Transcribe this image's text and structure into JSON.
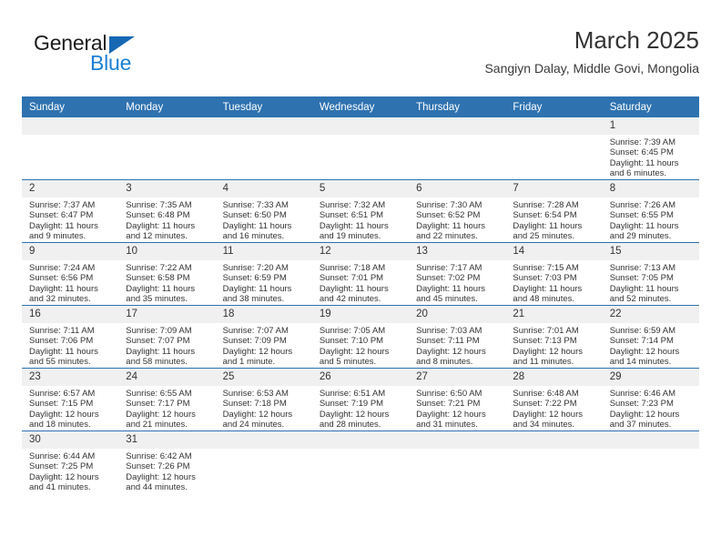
{
  "logo": {
    "word_one": "General",
    "word_two": "Blue",
    "triangle_icon": "blue-triangle-icon",
    "accent_color": "#1668b3",
    "blue_text_color": "#1b7fd4"
  },
  "header": {
    "title": "March 2025",
    "subtitle": "Sangiyn Dalay, Middle Govi, Mongolia"
  },
  "theme": {
    "header_blue": "#2e72b0",
    "daynum_gray": "#f0f0f0",
    "text": "#333333"
  },
  "weekday_headers": [
    "Sunday",
    "Monday",
    "Tuesday",
    "Wednesday",
    "Thursday",
    "Friday",
    "Saturday"
  ],
  "labels": {
    "sunrise_prefix": "Sunrise:",
    "sunset_prefix": "Sunset:",
    "daylight_prefix": "Daylight:"
  },
  "weeks": [
    [
      {
        "day": "",
        "blank": true
      },
      {
        "day": "",
        "blank": true
      },
      {
        "day": "",
        "blank": true
      },
      {
        "day": "",
        "blank": true
      },
      {
        "day": "",
        "blank": true
      },
      {
        "day": "",
        "blank": true
      },
      {
        "day": "1",
        "sunrise": "Sunrise: 7:39 AM",
        "sunset": "Sunset: 6:45 PM",
        "daylight_1": "Daylight: 11 hours",
        "daylight_2": "and 6 minutes."
      }
    ],
    [
      {
        "day": "2",
        "sunrise": "Sunrise: 7:37 AM",
        "sunset": "Sunset: 6:47 PM",
        "daylight_1": "Daylight: 11 hours",
        "daylight_2": "and 9 minutes."
      },
      {
        "day": "3",
        "sunrise": "Sunrise: 7:35 AM",
        "sunset": "Sunset: 6:48 PM",
        "daylight_1": "Daylight: 11 hours",
        "daylight_2": "and 12 minutes."
      },
      {
        "day": "4",
        "sunrise": "Sunrise: 7:33 AM",
        "sunset": "Sunset: 6:50 PM",
        "daylight_1": "Daylight: 11 hours",
        "daylight_2": "and 16 minutes."
      },
      {
        "day": "5",
        "sunrise": "Sunrise: 7:32 AM",
        "sunset": "Sunset: 6:51 PM",
        "daylight_1": "Daylight: 11 hours",
        "daylight_2": "and 19 minutes."
      },
      {
        "day": "6",
        "sunrise": "Sunrise: 7:30 AM",
        "sunset": "Sunset: 6:52 PM",
        "daylight_1": "Daylight: 11 hours",
        "daylight_2": "and 22 minutes."
      },
      {
        "day": "7",
        "sunrise": "Sunrise: 7:28 AM",
        "sunset": "Sunset: 6:54 PM",
        "daylight_1": "Daylight: 11 hours",
        "daylight_2": "and 25 minutes."
      },
      {
        "day": "8",
        "sunrise": "Sunrise: 7:26 AM",
        "sunset": "Sunset: 6:55 PM",
        "daylight_1": "Daylight: 11 hours",
        "daylight_2": "and 29 minutes."
      }
    ],
    [
      {
        "day": "9",
        "sunrise": "Sunrise: 7:24 AM",
        "sunset": "Sunset: 6:56 PM",
        "daylight_1": "Daylight: 11 hours",
        "daylight_2": "and 32 minutes."
      },
      {
        "day": "10",
        "sunrise": "Sunrise: 7:22 AM",
        "sunset": "Sunset: 6:58 PM",
        "daylight_1": "Daylight: 11 hours",
        "daylight_2": "and 35 minutes."
      },
      {
        "day": "11",
        "sunrise": "Sunrise: 7:20 AM",
        "sunset": "Sunset: 6:59 PM",
        "daylight_1": "Daylight: 11 hours",
        "daylight_2": "and 38 minutes."
      },
      {
        "day": "12",
        "sunrise": "Sunrise: 7:18 AM",
        "sunset": "Sunset: 7:01 PM",
        "daylight_1": "Daylight: 11 hours",
        "daylight_2": "and 42 minutes."
      },
      {
        "day": "13",
        "sunrise": "Sunrise: 7:17 AM",
        "sunset": "Sunset: 7:02 PM",
        "daylight_1": "Daylight: 11 hours",
        "daylight_2": "and 45 minutes."
      },
      {
        "day": "14",
        "sunrise": "Sunrise: 7:15 AM",
        "sunset": "Sunset: 7:03 PM",
        "daylight_1": "Daylight: 11 hours",
        "daylight_2": "and 48 minutes."
      },
      {
        "day": "15",
        "sunrise": "Sunrise: 7:13 AM",
        "sunset": "Sunset: 7:05 PM",
        "daylight_1": "Daylight: 11 hours",
        "daylight_2": "and 52 minutes."
      }
    ],
    [
      {
        "day": "16",
        "sunrise": "Sunrise: 7:11 AM",
        "sunset": "Sunset: 7:06 PM",
        "daylight_1": "Daylight: 11 hours",
        "daylight_2": "and 55 minutes."
      },
      {
        "day": "17",
        "sunrise": "Sunrise: 7:09 AM",
        "sunset": "Sunset: 7:07 PM",
        "daylight_1": "Daylight: 11 hours",
        "daylight_2": "and 58 minutes."
      },
      {
        "day": "18",
        "sunrise": "Sunrise: 7:07 AM",
        "sunset": "Sunset: 7:09 PM",
        "daylight_1": "Daylight: 12 hours",
        "daylight_2": "and 1 minute."
      },
      {
        "day": "19",
        "sunrise": "Sunrise: 7:05 AM",
        "sunset": "Sunset: 7:10 PM",
        "daylight_1": "Daylight: 12 hours",
        "daylight_2": "and 5 minutes."
      },
      {
        "day": "20",
        "sunrise": "Sunrise: 7:03 AM",
        "sunset": "Sunset: 7:11 PM",
        "daylight_1": "Daylight: 12 hours",
        "daylight_2": "and 8 minutes."
      },
      {
        "day": "21",
        "sunrise": "Sunrise: 7:01 AM",
        "sunset": "Sunset: 7:13 PM",
        "daylight_1": "Daylight: 12 hours",
        "daylight_2": "and 11 minutes."
      },
      {
        "day": "22",
        "sunrise": "Sunrise: 6:59 AM",
        "sunset": "Sunset: 7:14 PM",
        "daylight_1": "Daylight: 12 hours",
        "daylight_2": "and 14 minutes."
      }
    ],
    [
      {
        "day": "23",
        "sunrise": "Sunrise: 6:57 AM",
        "sunset": "Sunset: 7:15 PM",
        "daylight_1": "Daylight: 12 hours",
        "daylight_2": "and 18 minutes."
      },
      {
        "day": "24",
        "sunrise": "Sunrise: 6:55 AM",
        "sunset": "Sunset: 7:17 PM",
        "daylight_1": "Daylight: 12 hours",
        "daylight_2": "and 21 minutes."
      },
      {
        "day": "25",
        "sunrise": "Sunrise: 6:53 AM",
        "sunset": "Sunset: 7:18 PM",
        "daylight_1": "Daylight: 12 hours",
        "daylight_2": "and 24 minutes."
      },
      {
        "day": "26",
        "sunrise": "Sunrise: 6:51 AM",
        "sunset": "Sunset: 7:19 PM",
        "daylight_1": "Daylight: 12 hours",
        "daylight_2": "and 28 minutes."
      },
      {
        "day": "27",
        "sunrise": "Sunrise: 6:50 AM",
        "sunset": "Sunset: 7:21 PM",
        "daylight_1": "Daylight: 12 hours",
        "daylight_2": "and 31 minutes."
      },
      {
        "day": "28",
        "sunrise": "Sunrise: 6:48 AM",
        "sunset": "Sunset: 7:22 PM",
        "daylight_1": "Daylight: 12 hours",
        "daylight_2": "and 34 minutes."
      },
      {
        "day": "29",
        "sunrise": "Sunrise: 6:46 AM",
        "sunset": "Sunset: 7:23 PM",
        "daylight_1": "Daylight: 12 hours",
        "daylight_2": "and 37 minutes."
      }
    ],
    [
      {
        "day": "30",
        "sunrise": "Sunrise: 6:44 AM",
        "sunset": "Sunset: 7:25 PM",
        "daylight_1": "Daylight: 12 hours",
        "daylight_2": "and 41 minutes."
      },
      {
        "day": "31",
        "sunrise": "Sunrise: 6:42 AM",
        "sunset": "Sunset: 7:26 PM",
        "daylight_1": "Daylight: 12 hours",
        "daylight_2": "and 44 minutes."
      },
      {
        "day": "",
        "blank": true
      },
      {
        "day": "",
        "blank": true
      },
      {
        "day": "",
        "blank": true
      },
      {
        "day": "",
        "blank": true
      },
      {
        "day": "",
        "blank": true
      }
    ]
  ]
}
